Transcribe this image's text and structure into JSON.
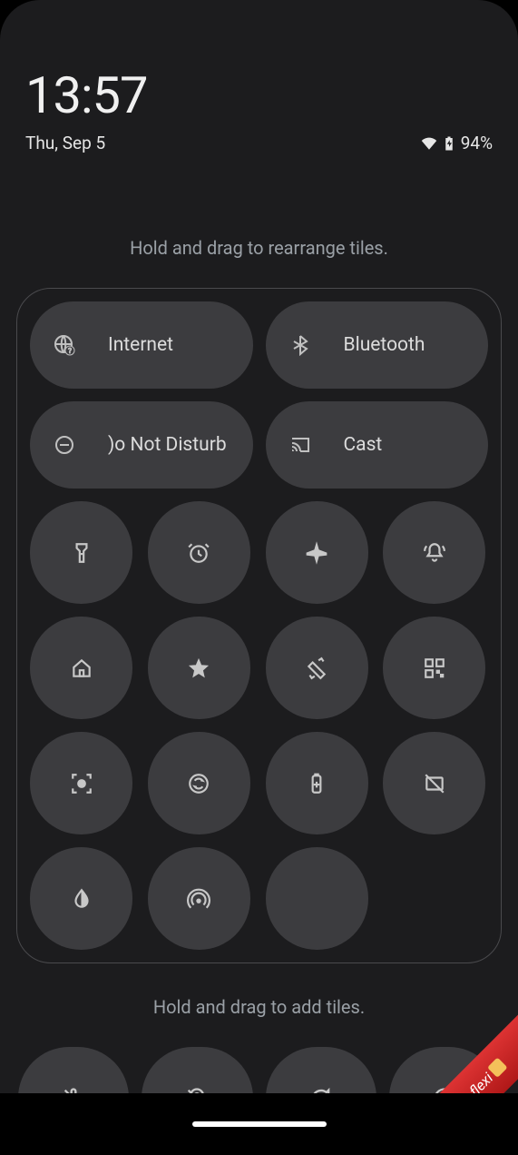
{
  "status": {
    "time": "13:57",
    "date": "Thu, Sep 5",
    "battery_text": "94%"
  },
  "hints": {
    "rearrange": "Hold and drag to rearrange tiles.",
    "add": "Hold and drag to add tiles."
  },
  "wide_tiles": [
    {
      "icon": "globe-question-icon",
      "label": "Internet"
    },
    {
      "icon": "bluetooth-icon",
      "label": "Bluetooth"
    },
    {
      "icon": "dnd-icon",
      "label": ")o Not Disturb"
    },
    {
      "icon": "cast-icon",
      "label": "Cast"
    }
  ],
  "small_tiles": [
    "flashlight-icon",
    "alarm-icon",
    "airplane-icon",
    "bell-ring-icon",
    "home-icon",
    "star-icon",
    "rotate-icon",
    "qr-icon",
    "focus-icon",
    "sync-icon",
    "battery-saver-icon",
    "screenshot-off-icon",
    "invert-icon",
    "hotspot-icon",
    "empty"
  ],
  "bottom_tiles": [
    "mic-off-icon",
    "location-off-icon",
    "refresh-icon",
    "contrast-icon"
  ],
  "watermark": "flexi"
}
